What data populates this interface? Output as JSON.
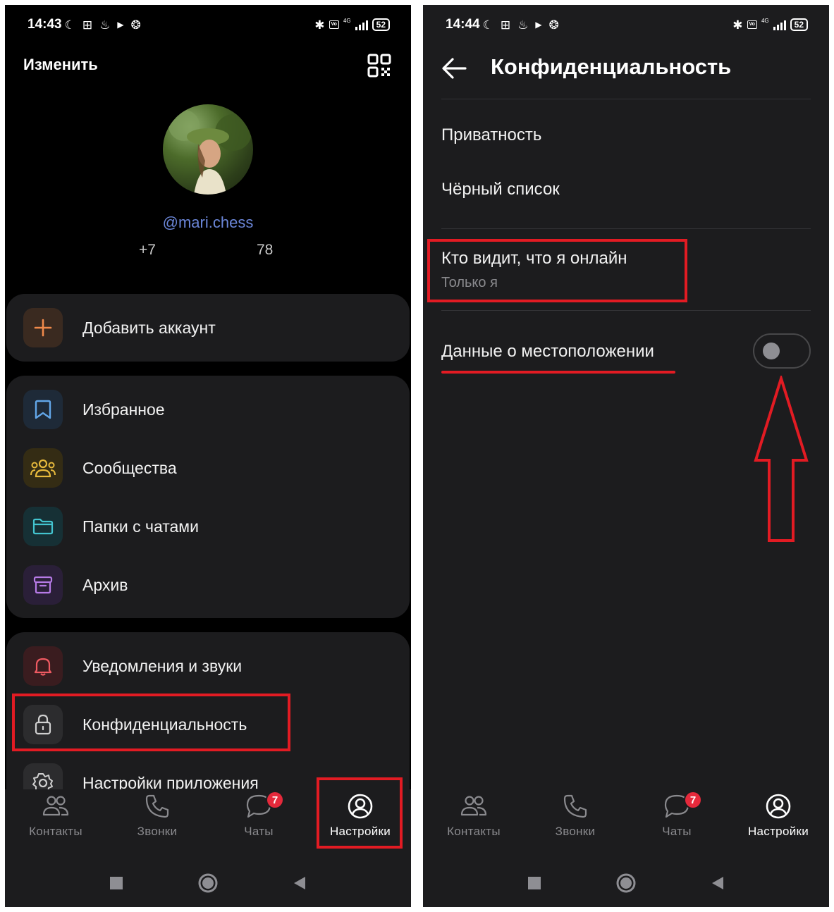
{
  "left": {
    "status_time": "14:43",
    "battery": "52",
    "network": "4G",
    "edit": "Изменить",
    "username": "@mari.chess",
    "phone": "+7",
    "phone_digits": "78",
    "add_account": "Добавить аккаунт",
    "menu": {
      "favorites": "Избранное",
      "communities": "Сообщества",
      "folders": "Папки с чатами",
      "archive": "Архив",
      "notifications": "Уведомления и звуки",
      "privacy": "Конфиденциальность",
      "app_settings": "Настройки приложения"
    }
  },
  "right": {
    "status_time": "14:44",
    "battery": "52",
    "network": "4G",
    "title": "Конфиденциальность",
    "privacy": "Приватность",
    "blacklist": "Чёрный список",
    "online_title": "Кто видит, что я онлайн",
    "online_value": "Только я",
    "location": "Данные о местоположении",
    "location_toggle": "off"
  },
  "tabs": {
    "contacts": "Контакты",
    "calls": "Звонки",
    "chats": "Чаты",
    "settings": "Настройки",
    "chats_badge": "7"
  },
  "colors": {
    "highlight": "#e21b23",
    "accent_username": "#6b86d8",
    "badge": "#e5293b"
  }
}
